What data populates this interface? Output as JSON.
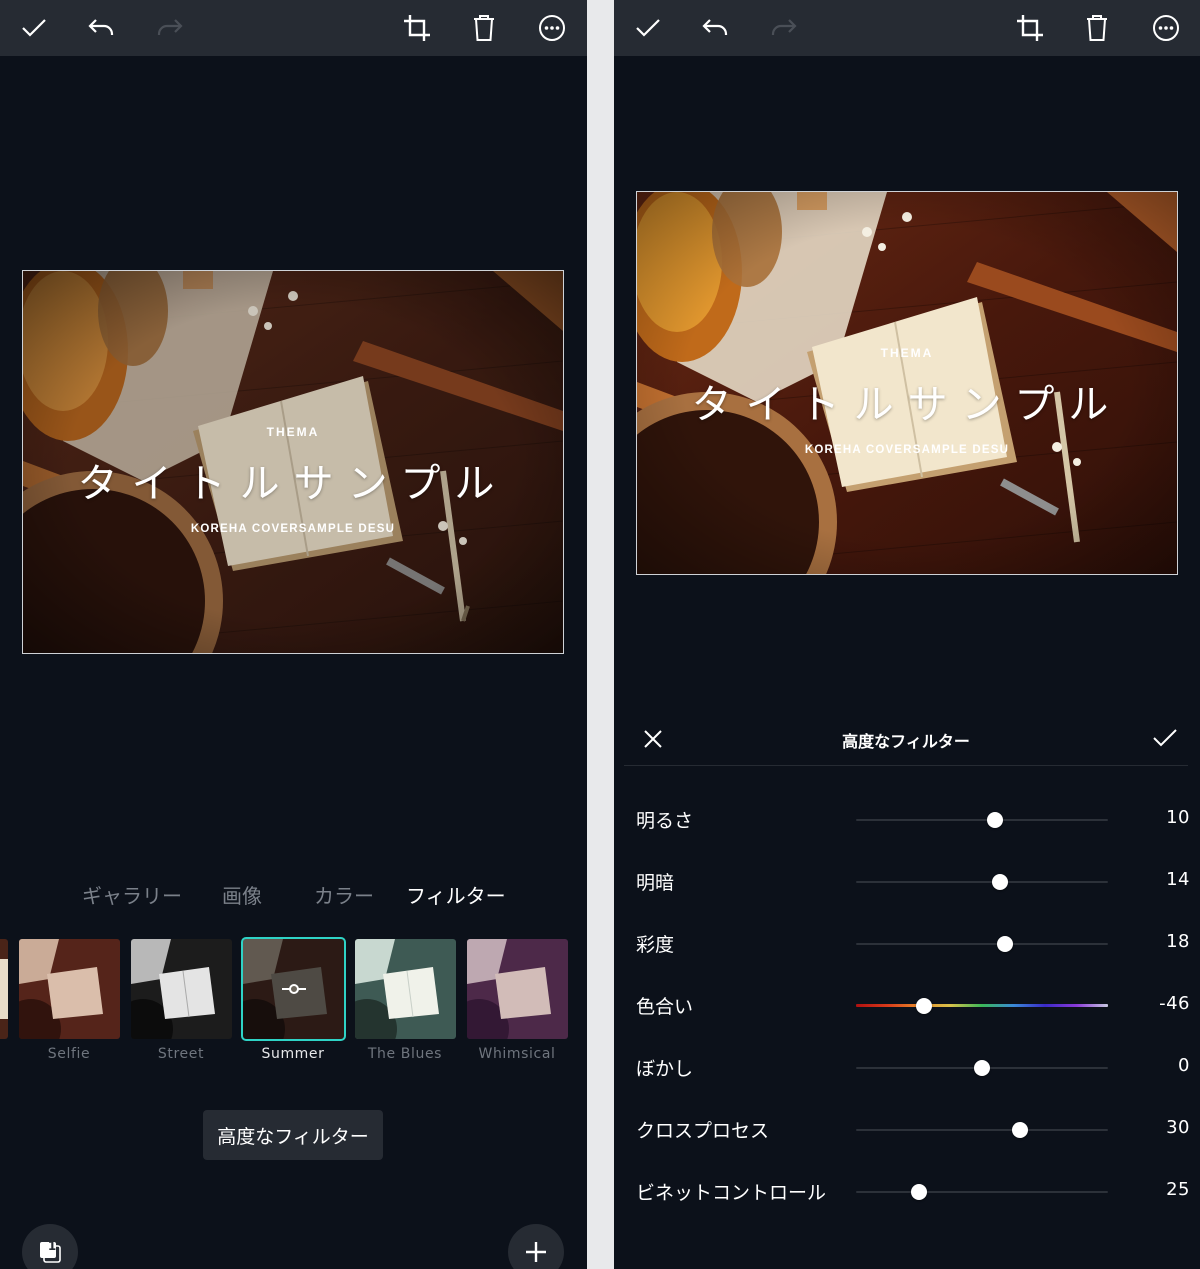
{
  "cover": {
    "thema": "THEMA",
    "title": "タイトルサンプル",
    "subtitle": "KOREHA COVERSAMPLE DESU"
  },
  "left_panel": {
    "tabs": [
      {
        "label": "ギャラリー",
        "active": false
      },
      {
        "label": "画像",
        "active": false
      },
      {
        "label": "カラー",
        "active": false
      },
      {
        "label": "フィルター",
        "active": true
      }
    ],
    "filters": [
      {
        "label": "Selfie",
        "selected": false
      },
      {
        "label": "Street",
        "selected": false
      },
      {
        "label": "Summer",
        "selected": true
      },
      {
        "label": "The Blues",
        "selected": false
      },
      {
        "label": "Whimsical",
        "selected": false
      }
    ],
    "advanced_button_label": "高度なフィルター",
    "page_badge": "1"
  },
  "right_panel": {
    "panel_title": "高度なフィルター",
    "adjustments": [
      {
        "label": "明るさ",
        "value": "10",
        "fraction": 0.55
      },
      {
        "label": "明暗",
        "value": "14",
        "fraction": 0.57
      },
      {
        "label": "彩度",
        "value": "18",
        "fraction": 0.59
      },
      {
        "label": "色合い",
        "value": "-46",
        "fraction": 0.27
      },
      {
        "label": "ぼかし",
        "value": "0",
        "fraction": 0.5
      },
      {
        "label": "クロスプロセス",
        "value": "30",
        "fraction": 0.65
      },
      {
        "label": "ビネットコントロール",
        "value": "25",
        "fraction": 0.25
      }
    ]
  },
  "colors": {
    "pane_bg": "#0c111a",
    "toolbar_bg": "#262b33",
    "accent_selected": "#2fd3c6",
    "inactive_text": "#7b818a"
  },
  "icons": {
    "confirm": "check-icon",
    "undo": "undo-icon",
    "redo": "redo-icon",
    "crop": "crop-icon",
    "delete": "trash-icon",
    "more": "more-icon",
    "close": "close-icon",
    "add": "plus-icon",
    "pages": "pages-icon",
    "filter_adjust": "slider-adjust-icon"
  }
}
